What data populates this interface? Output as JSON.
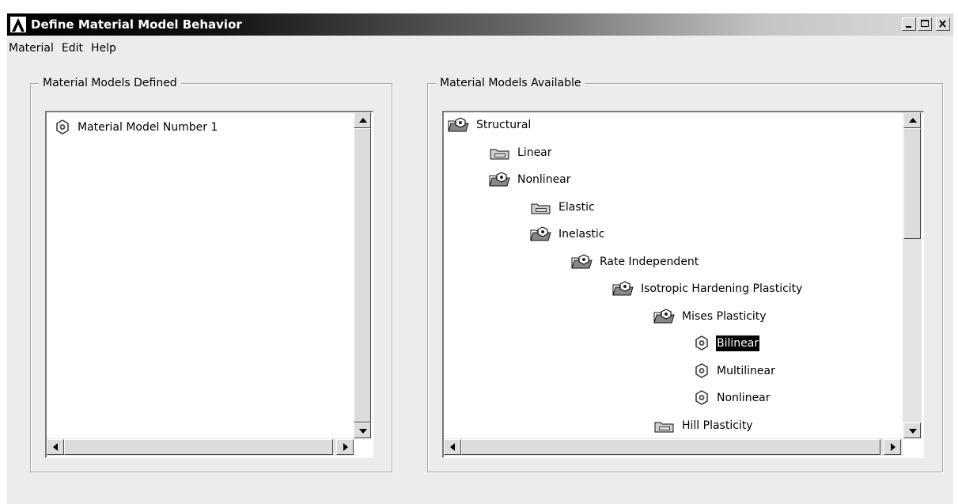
{
  "window": {
    "title": "Define Material Model Behavior",
    "controls": [
      "minimize",
      "maximize",
      "close"
    ]
  },
  "menubar": {
    "items": [
      "Material",
      "Edit",
      "Help"
    ]
  },
  "defined_panel": {
    "legend": "Material Models Defined",
    "items": [
      {
        "label": "Material Model Number 1",
        "icon": "material-gear-icon"
      }
    ]
  },
  "available_panel": {
    "legend": "Material Models Available",
    "tree": [
      {
        "label": "Structural",
        "icon": "folder-open-icon",
        "level": 0
      },
      {
        "label": "Linear",
        "icon": "folder-closed-icon",
        "level": 1
      },
      {
        "label": "Nonlinear",
        "icon": "folder-open-icon",
        "level": 1
      },
      {
        "label": "Elastic",
        "icon": "folder-closed-icon",
        "level": 2
      },
      {
        "label": "Inelastic",
        "icon": "folder-open-icon",
        "level": 2
      },
      {
        "label": "Rate Independent",
        "icon": "folder-open-icon",
        "level": 3
      },
      {
        "label": "Isotropic Hardening Plasticity",
        "icon": "folder-open-icon",
        "level": 4
      },
      {
        "label": "Mises Plasticity",
        "icon": "folder-open-icon",
        "level": 5
      },
      {
        "label": "Bilinear",
        "icon": "material-gear-icon",
        "level": 6,
        "selected": true
      },
      {
        "label": "Multilinear",
        "icon": "material-gear-icon",
        "level": 6
      },
      {
        "label": "Nonlinear",
        "icon": "material-gear-icon",
        "level": 6
      },
      {
        "label": "Hill Plasticity",
        "icon": "folder-closed-icon",
        "level": 5
      }
    ]
  },
  "colors": {
    "selection_bg": "#000000",
    "window_bg": "#ececec",
    "titlebar_dark": "#000000"
  }
}
